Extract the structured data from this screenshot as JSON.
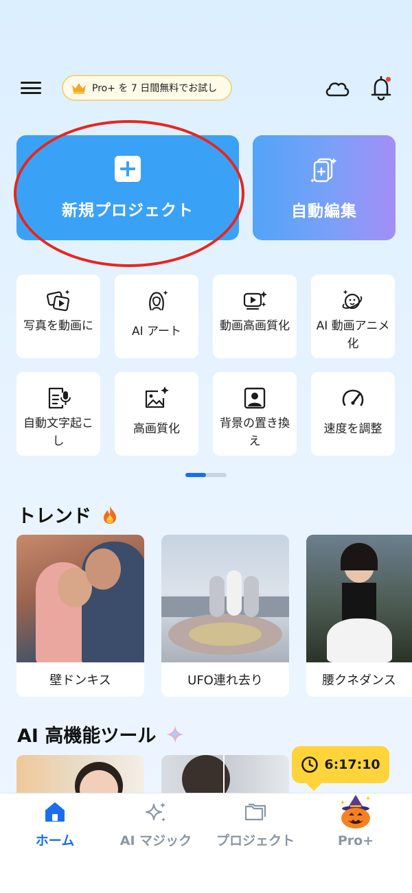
{
  "header": {
    "promo_text": "Pro+ を 7 日間無料でお試し"
  },
  "cards": {
    "new_project": "新規プロジェクト",
    "auto_edit": "自動編集"
  },
  "tools": [
    {
      "label": "写真を動画に",
      "icon": "photo-to-video-icon"
    },
    {
      "label": "AI アート",
      "icon": "ai-art-icon"
    },
    {
      "label": "動画高画質化",
      "icon": "video-enhance-icon"
    },
    {
      "label": "AI 動画アニメ化",
      "icon": "video-anime-icon"
    },
    {
      "label": "自動文字起こし",
      "icon": "transcribe-icon"
    },
    {
      "label": "高画質化",
      "icon": "image-enhance-icon"
    },
    {
      "label": "背景の置き換え",
      "icon": "background-replace-icon"
    },
    {
      "label": "速度を調整",
      "icon": "speed-icon"
    }
  ],
  "trend": {
    "title": "トレンド",
    "items": [
      {
        "caption": "壁ドンキス"
      },
      {
        "caption": "UFO連れ去り"
      },
      {
        "caption": "腰クネダンス"
      }
    ]
  },
  "ai_tools": {
    "title": "AI 高機能ツール"
  },
  "timer": "6:17:10",
  "nav": {
    "home": "ホーム",
    "ai_magic": "AI マジック",
    "projects": "プロジェクト",
    "pro": "Pro+"
  },
  "colors": {
    "accent": "#1a6df0",
    "new_project_card": "#3aa2f6",
    "timer": "#ffd43b",
    "highlight_ring": "#e8261c"
  }
}
